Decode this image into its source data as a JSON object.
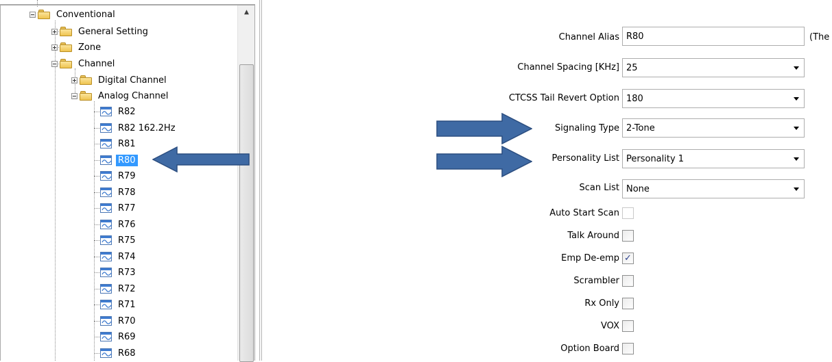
{
  "tree": {
    "root_label": "Conventional",
    "general_setting": "General Setting",
    "zone": "Zone",
    "channel": "Channel",
    "digital_channel": "Digital Channel",
    "analog_channel": "Analog Channel",
    "channels": [
      "R82",
      "R82 162.2Hz",
      "R81",
      "R80",
      "R79",
      "R78",
      "R77",
      "R76",
      "R75",
      "R74",
      "R73",
      "R72",
      "R71",
      "R70",
      "R69",
      "R68"
    ],
    "selected": "R80"
  },
  "form": {
    "channel_alias": {
      "label": "Channel Alias",
      "value": "R80",
      "suffix": "(The"
    },
    "channel_spacing": {
      "label": "Channel Spacing [KHz]",
      "value": "25"
    },
    "ctcss_tail": {
      "label": "CTCSS Tail Revert Option",
      "value": "180"
    },
    "signaling_type": {
      "label": "Signaling Type",
      "value": "2-Tone"
    },
    "personality_list": {
      "label": "Personality List",
      "value": "Personality 1"
    },
    "scan_list": {
      "label": "Scan List",
      "value": "None"
    },
    "auto_start_scan": {
      "label": "Auto Start Scan",
      "checked": false
    },
    "talk_around": {
      "label": "Talk Around",
      "checked": false
    },
    "emp_de_emp": {
      "label": "Emp De-emp",
      "checked": true,
      "mark": "✓"
    },
    "scrambler": {
      "label": "Scrambler",
      "checked": false
    },
    "rx_only": {
      "label": "Rx Only",
      "checked": false
    },
    "vox": {
      "label": "VOX",
      "checked": false
    },
    "option_board": {
      "label": "Option Board",
      "checked": false
    }
  },
  "colors": {
    "selection": "#3399ff",
    "arrow_fill": "#3f6aa4",
    "arrow_stroke": "#2c4e80"
  }
}
